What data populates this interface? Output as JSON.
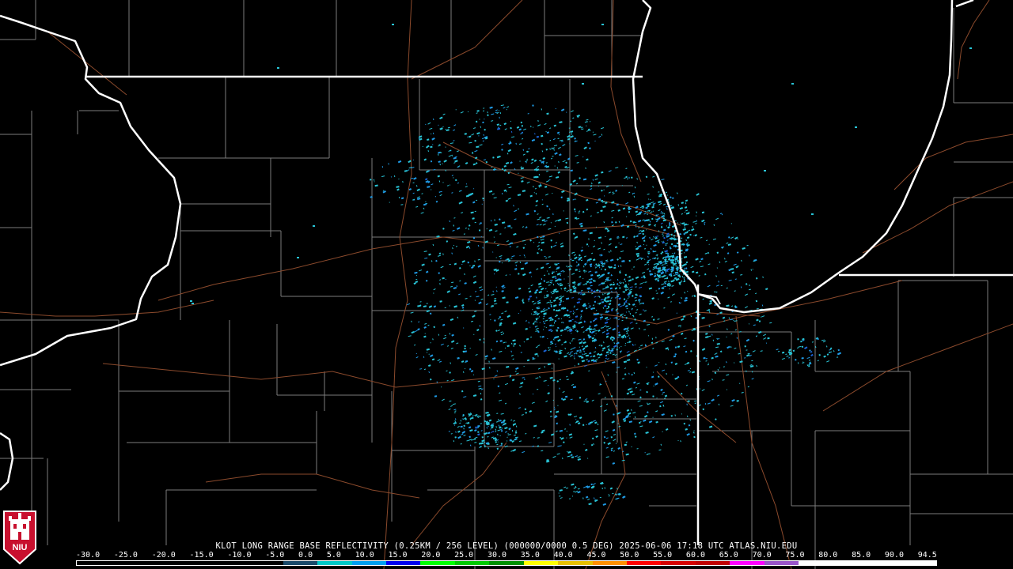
{
  "product": {
    "caption": "KLOT LONG RANGE BASE REFLECTIVITY (0.25KM / 256 LEVEL) (000000/0000 0.5 DEG) 2025-06-06 17:18 UTC  ATLAS.NIU.EDU"
  },
  "legend": {
    "labels": [
      "-30.0",
      "-25.0",
      "-20.0",
      "-15.0",
      "-10.0",
      "-5.0",
      "0.0",
      "5.0",
      "10.0",
      "15.0",
      "20.0",
      "25.0",
      "30.0",
      "35.0",
      "40.0",
      "45.0",
      "50.0",
      "55.0",
      "60.0",
      "65.0",
      "70.0",
      "75.0",
      "80.0",
      "85.0",
      "90.0",
      "94.5"
    ],
    "colors": [
      "#000000",
      "#000000",
      "#000000",
      "#000000",
      "#000000",
      "#000000",
      "#1a4a6a",
      "#00c8c8",
      "#00a0f0",
      "#0000f0",
      "#00ff00",
      "#00c800",
      "#009000",
      "#ffff00",
      "#e7c000",
      "#ff9000",
      "#ff0000",
      "#d60000",
      "#c00000",
      "#ff00ff",
      "#9955c9",
      "#ffffff",
      "#ffffff",
      "#ffffff",
      "#ffffff"
    ]
  },
  "logo": {
    "text": "NIU"
  },
  "colors": {
    "state_border": "#ffffff",
    "county_line": "#7c7c7c",
    "highway": "#8b4a2c",
    "echo_light": "#29c4d6",
    "echo_mid": "#1f9be6",
    "echo_dark": "#1c64d8"
  }
}
